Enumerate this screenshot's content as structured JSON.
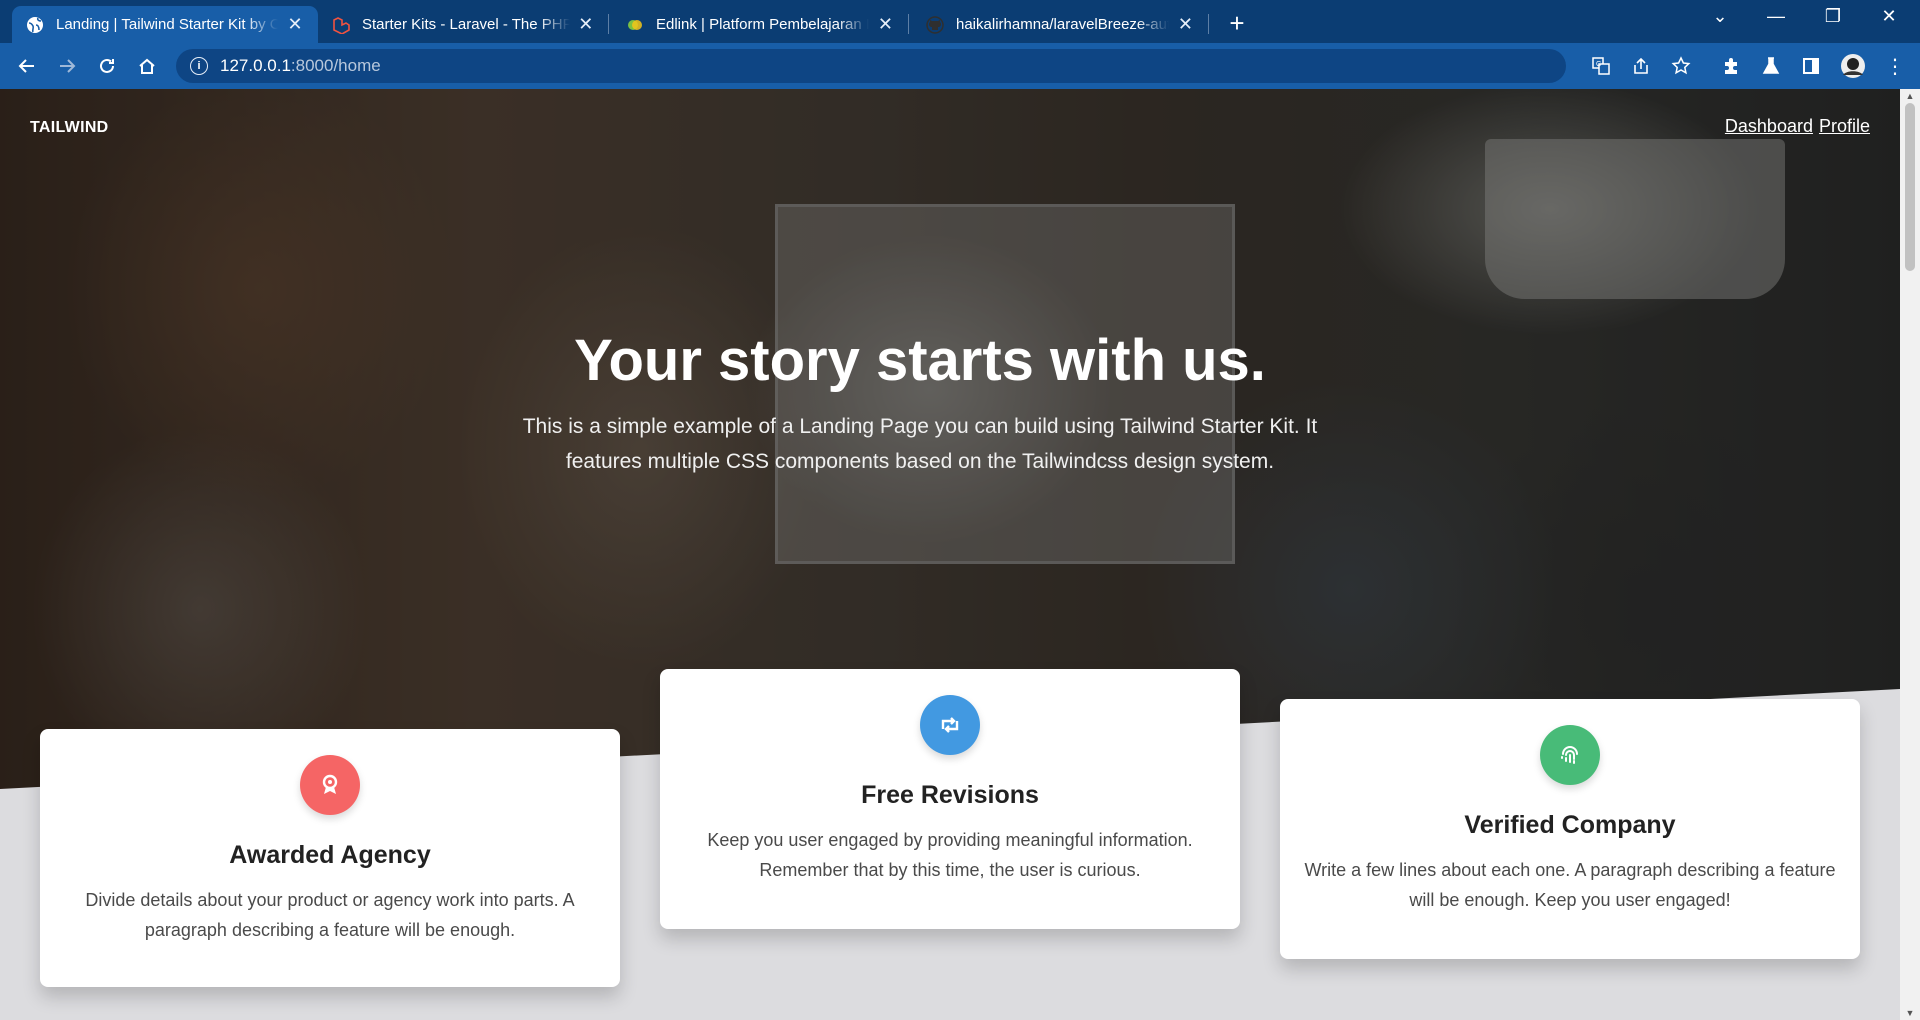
{
  "browser": {
    "tabs": [
      {
        "title": "Landing | Tailwind Starter Kit by C",
        "active": true,
        "favicon": "globe-icon"
      },
      {
        "title": "Starter Kits - Laravel - The PHP Fr",
        "active": false,
        "favicon": "laravel-icon"
      },
      {
        "title": "Edlink | Platform Pembelajaran In",
        "active": false,
        "favicon": "edlink-icon"
      },
      {
        "title": "haikalirhamna/laravelBreeze-auth",
        "active": false,
        "favicon": "github-icon"
      }
    ],
    "url_host": "127.0.0.1",
    "url_path": ":8000/home"
  },
  "nav": {
    "brand": "TAILWIND",
    "links": [
      "Dashboard",
      "Profile"
    ]
  },
  "hero": {
    "title": "Your story starts with us.",
    "subtitle": "This is a simple example of a Landing Page you can build using Tailwind Starter Kit. It features multiple CSS components based on the Tailwindcss design system."
  },
  "features": [
    {
      "title": "Awarded Agency",
      "text": "Divide details about your product or agency work into parts. A paragraph describing a feature will be enough.",
      "icon": "award-icon",
      "color": "#f56565"
    },
    {
      "title": "Free Revisions",
      "text": "Keep you user engaged by providing meaningful information. Remember that by this time, the user is curious.",
      "icon": "retweet-icon",
      "color": "#4299e1"
    },
    {
      "title": "Verified Company",
      "text": "Write a few lines about each one. A paragraph describing a feature will be enough. Keep you user engaged!",
      "icon": "fingerprint-icon",
      "color": "#48bb78"
    }
  ],
  "colors": {
    "chrome_dark": "#0b3d73",
    "chrome": "#185ea8",
    "page_bg": "#dcdcdf"
  }
}
